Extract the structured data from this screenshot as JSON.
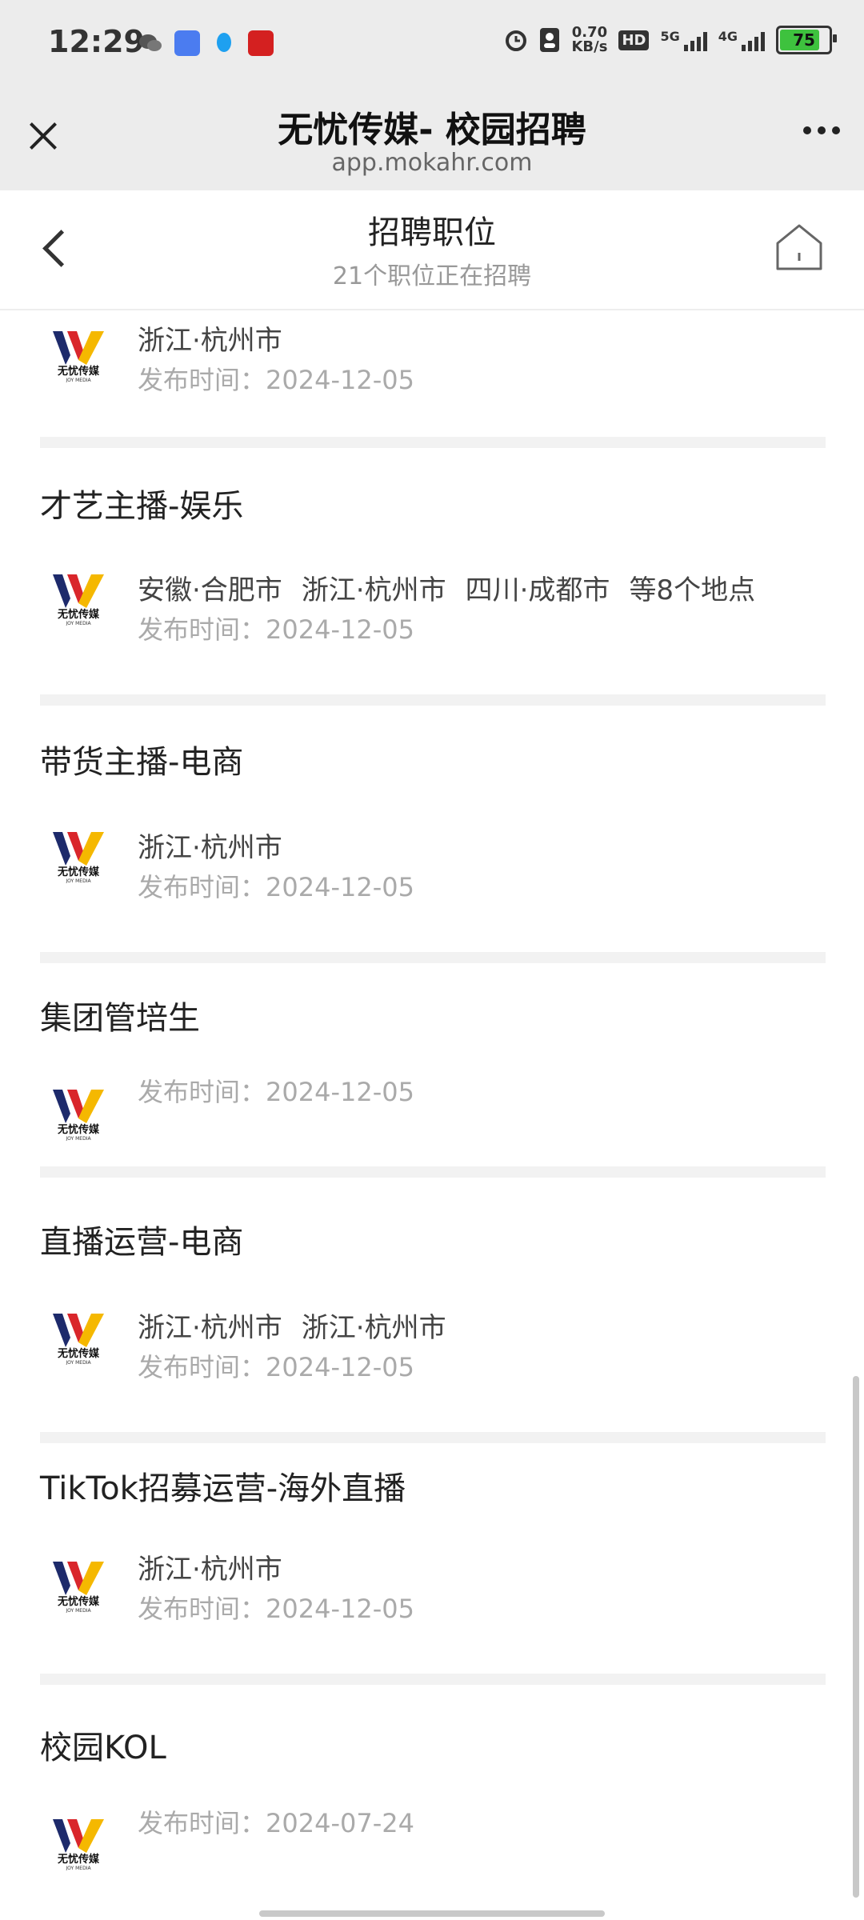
{
  "status_bar": {
    "time": "12:29",
    "net_speed_value": "0.70",
    "net_speed_unit": "KB/s",
    "hd_label": "HD",
    "signal1_label": "5G",
    "signal2_label": "4G",
    "battery": "75",
    "icons": [
      "wechat-icon",
      "weather-icon",
      "qq-icon",
      "red-app-icon",
      "alarm-icon",
      "contact-icon"
    ]
  },
  "browser": {
    "title": "无忧传媒- 校园招聘",
    "host": "app.mokahr.com"
  },
  "navbar": {
    "title": "招聘职位",
    "subtitle": "21个职位正在招聘"
  },
  "jobs": [
    {
      "title": "",
      "locations": [
        "浙江·杭州市"
      ],
      "date": "发布时间：2024-12-05"
    },
    {
      "title": "才艺主播-娱乐",
      "locations": [
        "安徽·合肥市",
        "浙江·杭州市",
        "四川·成都市",
        "等8个地点"
      ],
      "date": "发布时间：2024-12-05"
    },
    {
      "title": "带货主播-电商",
      "locations": [
        "浙江·杭州市"
      ],
      "date": "发布时间：2024-12-05"
    },
    {
      "title": "集团管培生",
      "locations": [],
      "date": "发布时间：2024-12-05"
    },
    {
      "title": "直播运营-电商",
      "locations": [
        "浙江·杭州市",
        "浙江·杭州市"
      ],
      "date": "发布时间：2024-12-05"
    },
    {
      "title": "TikTok招募运营-海外直播",
      "locations": [
        "浙江·杭州市"
      ],
      "date": "发布时间：2024-12-05"
    },
    {
      "title": "校园KOL",
      "locations": [],
      "date": "发布时间：2024-07-24"
    }
  ],
  "logo_text": "无忧传媒",
  "logo_subtext": "JOY MEDIA",
  "colors": {
    "accent_yellow": "#f5b800",
    "accent_red": "#d9262b",
    "accent_navy": "#1d2a6b"
  }
}
